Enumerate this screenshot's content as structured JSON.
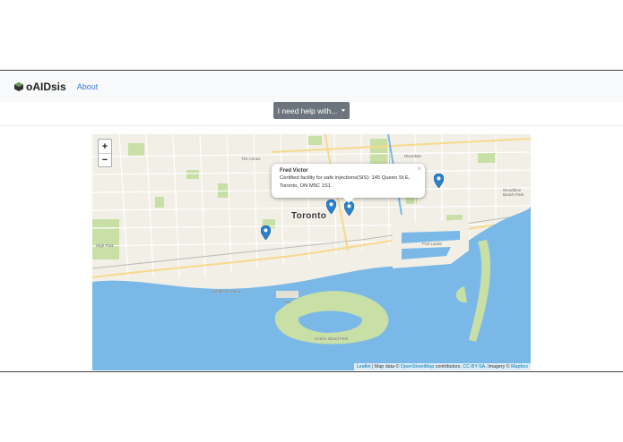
{
  "navbar": {
    "brand": "oAIDsis",
    "about_label": "About"
  },
  "toolbar": {
    "help_label": "I need help with..."
  },
  "map": {
    "city_label": "Toronto",
    "zoom_in_label": "+",
    "zoom_out_label": "−",
    "labels": {
      "the_annex": "The Annex",
      "riverdale": "Riverdale",
      "high_park": "High Park",
      "exhibition_place": "Exhibition Place",
      "centre_island": "Centre Island Park",
      "port_lands": "Port Lands",
      "ytz": "YTZ",
      "woodbine": "Woodbine Beach Park"
    },
    "popup": {
      "title": "Fred Victor",
      "body": "Certified facility for safe injections(SIS): 145 Queen St E, Toronto, ON M5C 1S1",
      "close_label": "×"
    },
    "attribution": {
      "leaflet": "Leaflet",
      "sep1": " | Map data © ",
      "osm": "OpenStreetMap",
      "contrib": " contributors, ",
      "license": "CC-BY-SA",
      "imagery": ", Imagery © ",
      "mapbox": "Mapbox"
    },
    "colors": {
      "water": "#7ab8e8",
      "land": "#f1efe6",
      "park": "#c8dfa6",
      "marker": "#2b82cb"
    }
  }
}
